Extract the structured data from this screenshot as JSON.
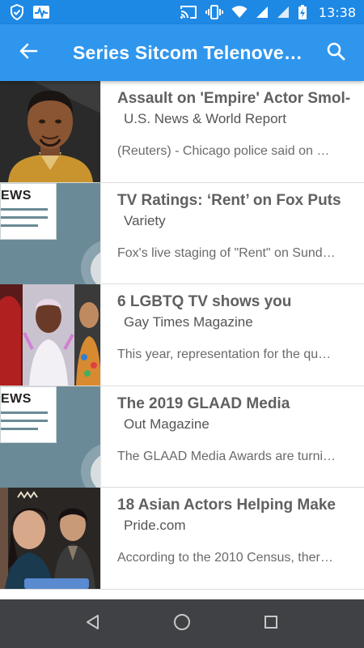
{
  "status_bar": {
    "time": "13:38",
    "icons": [
      "shield-icon",
      "activity-icon",
      "cast-icon",
      "vibrate-icon",
      "wifi-icon",
      "signal-icon",
      "signal-icon-2",
      "battery-charging-icon"
    ]
  },
  "app_bar": {
    "title": "Series Sitcom Telenovel…",
    "back_icon": "arrow-back-icon",
    "search_icon": "search-icon",
    "color": "#2f96ee"
  },
  "articles": [
    {
      "title": "Assault on 'Empire' Actor Smol-",
      "source": "U.S. News & World Report",
      "snippet": "(Reuters) - Chicago police said on …",
      "thumb": "portrait"
    },
    {
      "title": "TV Ratings: ‘Rent’ on Fox Puts",
      "source": "Variety",
      "snippet": "Fox's live staging of \"Rent\" on Sund…",
      "thumb": "news",
      "thumb_text": "EWS"
    },
    {
      "title": "6 LGBTQ TV shows you",
      "source": "Gay Times Magazine",
      "snippet": "This year, representation for the qu…",
      "thumb": "collage"
    },
    {
      "title": "The 2019 GLAAD Media",
      "source": "Out Magazine",
      "snippet": "The GLAAD Media Awards are turni…",
      "thumb": "news",
      "thumb_text": "EWS"
    },
    {
      "title": "18 Asian Actors Helping Make",
      "source": "Pride.com",
      "snippet": "According to the 2010 Census, ther…",
      "thumb": "cast"
    }
  ],
  "nav_bar": {
    "back_icon": "nav-back-icon",
    "home_icon": "nav-home-icon",
    "recents_icon": "nav-recents-icon"
  }
}
